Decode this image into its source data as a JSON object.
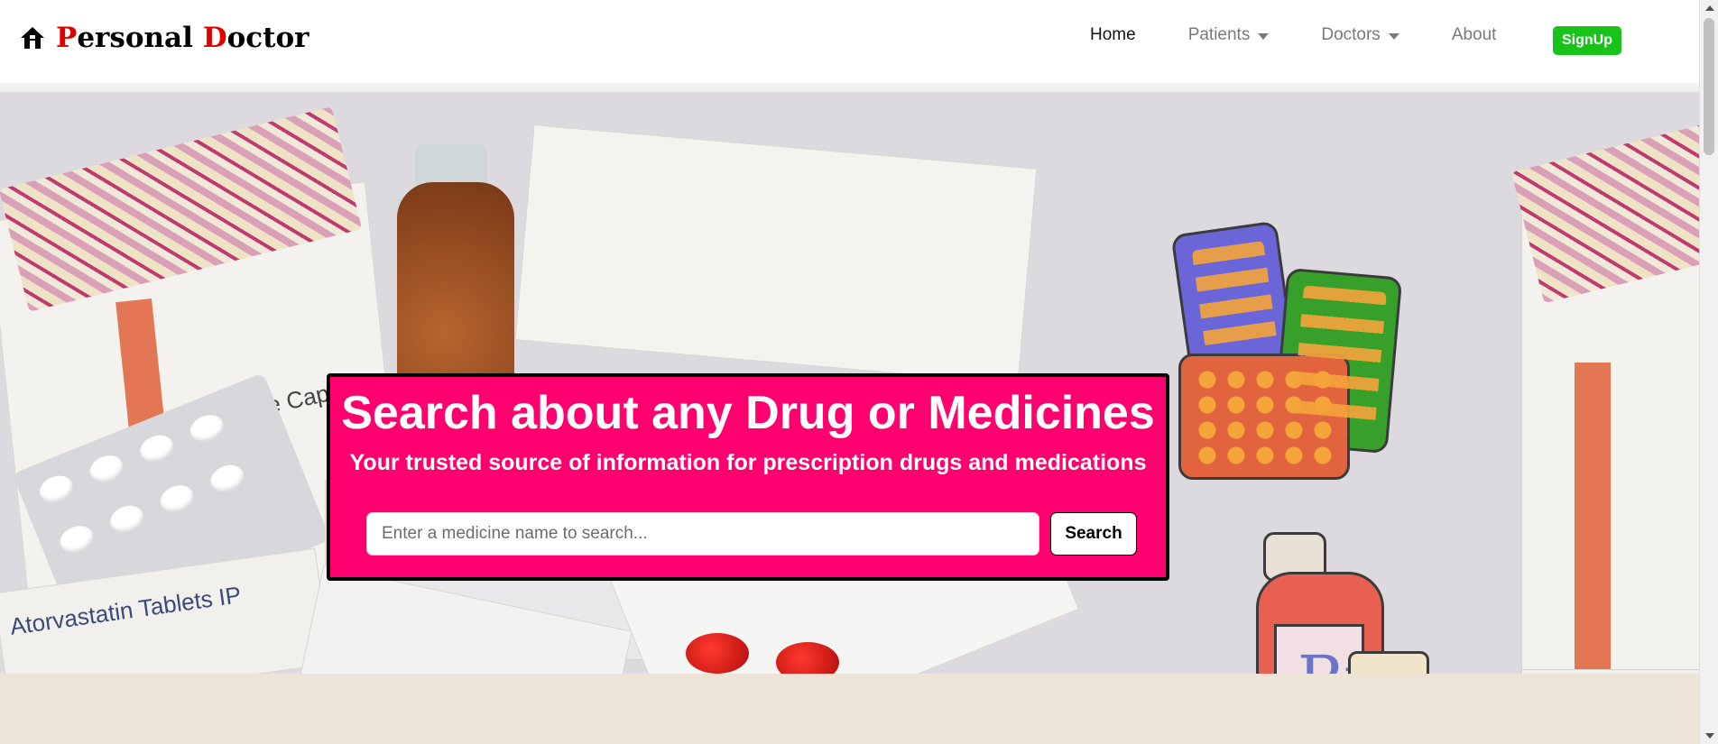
{
  "navbar": {
    "brand": {
      "first_letter": "P",
      "first_rest": "ersonal ",
      "second_letter": "D",
      "second_rest": "octor",
      "icon": "home-icon"
    },
    "links": [
      {
        "label": "Home",
        "active": true,
        "dropdown": false
      },
      {
        "label": "Patients",
        "active": false,
        "dropdown": true
      },
      {
        "label": "Doctors",
        "active": false,
        "dropdown": true
      },
      {
        "label": "About",
        "active": false,
        "dropdown": false
      }
    ],
    "signup_label": "SignUp"
  },
  "hero": {
    "title": "Search about any Drug or Medicines",
    "subtitle": "Your trusted source of information for prescription drugs and medications",
    "search": {
      "placeholder": "Enter a medicine name to search...",
      "value": "",
      "button_label": "Search"
    }
  },
  "colors": {
    "accent_pink": "#ff006e",
    "signup_green": "#19c41a",
    "brand_red": "#e00000"
  }
}
